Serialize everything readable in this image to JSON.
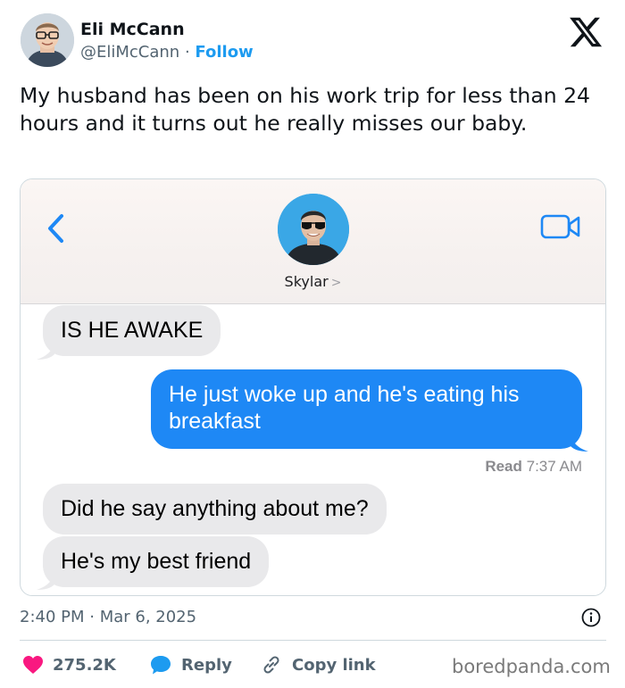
{
  "author": {
    "name": "Eli McCann",
    "handle": "@EliMcCann",
    "separator": "·",
    "follow_label": "Follow"
  },
  "tweet": {
    "text": "My husband has been on his work trip for less than 24 hours and it turns out he really misses our baby."
  },
  "chat": {
    "contact_name": "Skylar",
    "contact_chevron": ">",
    "messages": [
      {
        "direction": "incoming",
        "text": "IS HE AWAKE"
      },
      {
        "direction": "outgoing",
        "text": "He just woke up and he's eating his breakfast"
      },
      {
        "direction": "incoming",
        "text": "Did he say anything about me?"
      },
      {
        "direction": "incoming",
        "text": "He's my best friend"
      }
    ],
    "read_label": "Read",
    "read_time": "7:37 AM"
  },
  "meta": {
    "timestamp": "2:40 PM · Mar 6, 2025"
  },
  "actions": {
    "likes": "275.2K",
    "reply_label": "Reply",
    "copy_label": "Copy link"
  },
  "watermark": "boredpanda.com",
  "colors": {
    "accent": "#1d9bf0",
    "imessage_blue": "#1e88f5",
    "incoming_bubble": "#e9e9eb",
    "like_red": "#f91880"
  }
}
